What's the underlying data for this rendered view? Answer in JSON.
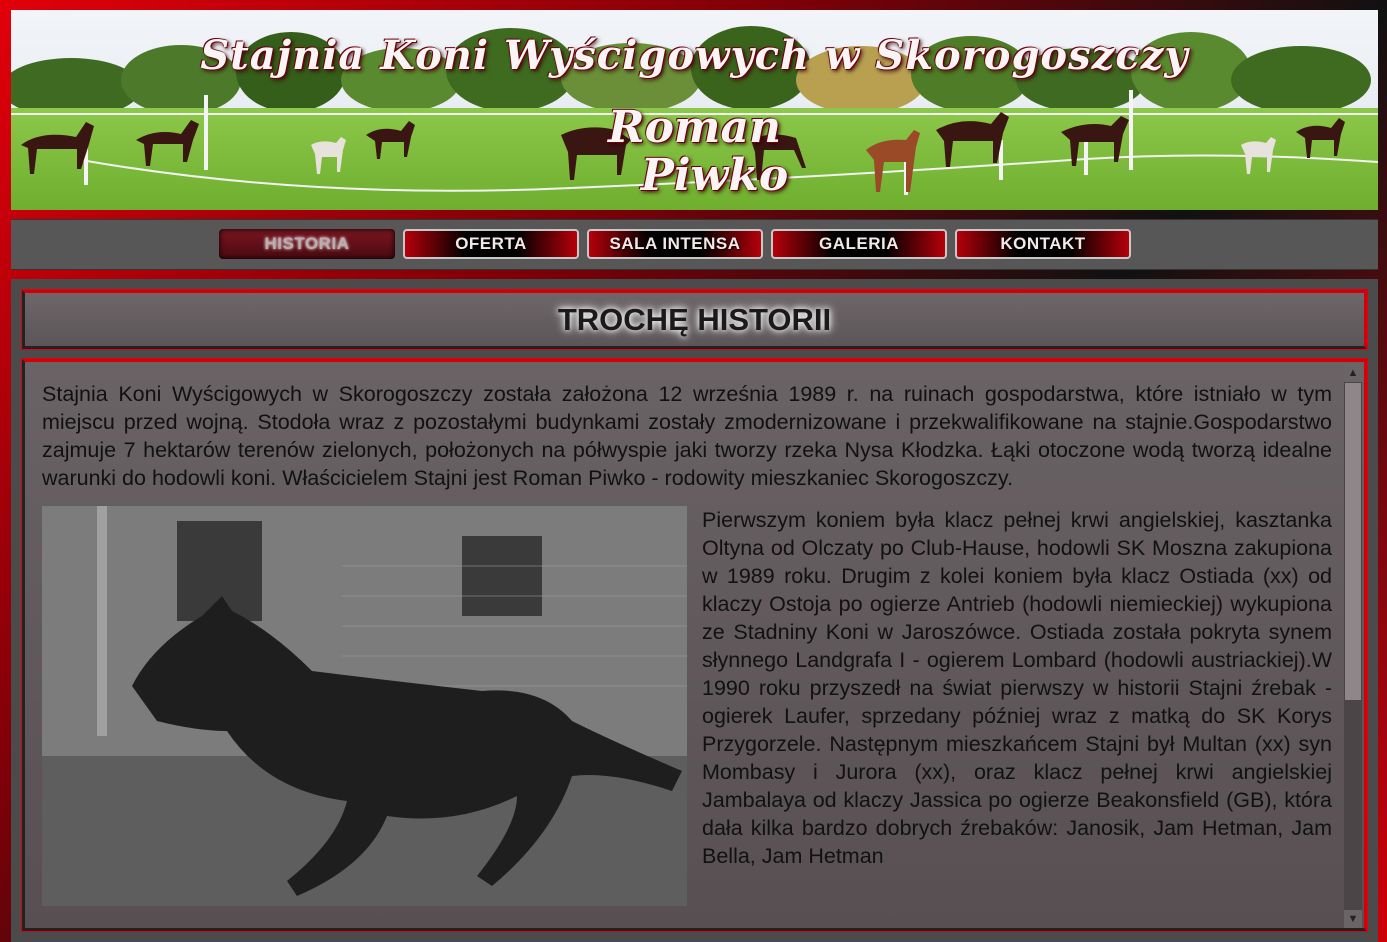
{
  "banner": {
    "title_line1": "Stajnia Koni Wyścigowych w Skorogoszczy",
    "title_line2": "Roman",
    "title_line3": "Piwko"
  },
  "nav": {
    "items": [
      {
        "label": "HISTORIA",
        "active": true
      },
      {
        "label": "OFERTA",
        "active": false
      },
      {
        "label": "SALA INTENSA",
        "active": false
      },
      {
        "label": "GALERIA",
        "active": false
      },
      {
        "label": "KONTAKT",
        "active": false
      }
    ]
  },
  "main": {
    "title": "TROCHĘ HISTORII",
    "paragraph1": "Stajnia Koni Wyścigowych w Skorogoszczy została założona 12 września 1989 r. na ruinach gospodarstwa, które istniało w tym miejscu przed wojną. Stodoła wraz z pozostałymi budynkami zostały zmodernizowane i przekwalifikowane na stajnie.Gospodarstwo zajmuje 7 hektarów terenów zielonych, położonych na półwyspie jaki tworzy rzeka Nysa Kłodzka. Łąki otoczone wodą tworzą idealne warunki do hodowli koni. Właścicielem Stajni jest Roman Piwko - rodowity mieszkaniec Skorogoszczy.",
    "paragraph2": "Pierwszym koniem była klacz pełnej krwi angielskiej, kasztanka Oltyna od Olczaty po Club-Hause, hodowli SK Moszna zakupiona w 1989 roku. Drugim z kolei koniem była klacz Ostiada (xx) od klaczy Ostoja po ogierze Antrieb (hodowli niemieckiej) wykupiona ze Stadniny Koni w Jaroszówce. Ostiada została pokryta synem słynnego Landgrafa I - ogierem Lombard (hodowli austriackiej).W 1990 roku przyszedł na świat pierwszy w historii Stajni źrebak - ogierek Laufer, sprzedany później wraz z matką do SK Korys Przygorzele. Następnym mieszkańcem Stajni był Multan (xx) syn Mombasy i Jurora (xx), oraz klacz pełnej krwi angielskiej Jambalaya od klaczy Jassica po ogierze Beakonsfield (GB), która dała kilka bardzo dobrych źrebaków: Janosik, Jam Hetman, Jam Bella, Jam Hetman",
    "scroll_up": "▲",
    "scroll_down": "▼"
  },
  "colors": {
    "accent_red": "#d0000a",
    "panel_gray": "#4b4b4b"
  }
}
